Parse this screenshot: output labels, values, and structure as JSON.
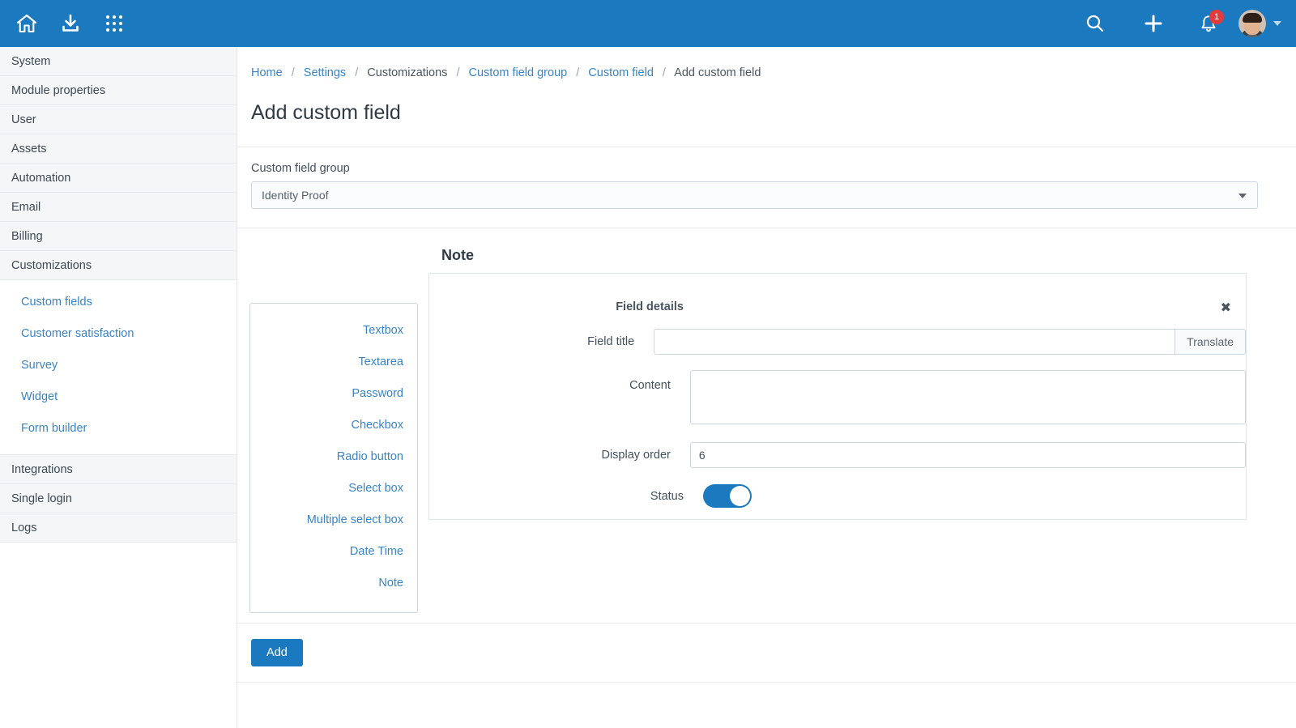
{
  "topbar": {
    "icons": [
      {
        "name": "home-icon",
        "label": "Home"
      },
      {
        "name": "download-icon",
        "label": "Download"
      },
      {
        "name": "apps-grid-icon",
        "label": "Apps"
      }
    ],
    "search_label": "Search",
    "add_label": "Add",
    "notification_label": "Notifications",
    "notification_count": "1",
    "avatar_label": "User profile",
    "brand_color": "#1b79c0",
    "badge_color": "#e23b3b"
  },
  "sidebar": {
    "items": [
      {
        "label": "System"
      },
      {
        "label": "Module properties"
      },
      {
        "label": "User"
      },
      {
        "label": "Assets"
      },
      {
        "label": "Automation"
      },
      {
        "label": "Email"
      },
      {
        "label": "Billing"
      },
      {
        "label": "Customizations"
      }
    ],
    "sub_items": [
      {
        "label": "Custom fields"
      },
      {
        "label": "Customer satisfaction"
      },
      {
        "label": "Survey"
      },
      {
        "label": "Widget"
      },
      {
        "label": "Form builder"
      }
    ],
    "items_after": [
      {
        "label": "Integrations"
      },
      {
        "label": "Single login"
      },
      {
        "label": "Logs"
      }
    ]
  },
  "breadcrumb": {
    "items": [
      {
        "label": "Home",
        "link": true
      },
      {
        "label": "Settings",
        "link": true
      },
      {
        "label": "Customizations",
        "link": false
      },
      {
        "label": "Custom field group",
        "link": true
      },
      {
        "label": "Custom field",
        "link": true
      },
      {
        "label": "Add custom field",
        "link": false
      }
    ],
    "separator": "/"
  },
  "page": {
    "title": "Add custom field",
    "group_label": "Custom field group",
    "group_value": "Identity Proof"
  },
  "field_types": [
    {
      "label": "Textbox"
    },
    {
      "label": "Textarea"
    },
    {
      "label": "Password"
    },
    {
      "label": "Checkbox"
    },
    {
      "label": "Radio button"
    },
    {
      "label": "Select box"
    },
    {
      "label": "Multiple select box"
    },
    {
      "label": "Date Time"
    },
    {
      "label": "Note"
    }
  ],
  "note_panel": {
    "heading": "Note",
    "section_label": "Field details",
    "close_label": "✖",
    "field_title_label": "Field title",
    "field_title_value": "",
    "translate_label": "Translate",
    "content_label": "Content",
    "content_value": "",
    "display_order_label": "Display order",
    "display_order_value": "6",
    "status_label": "Status",
    "status_on": "true"
  },
  "footer": {
    "add_label": "Add"
  }
}
